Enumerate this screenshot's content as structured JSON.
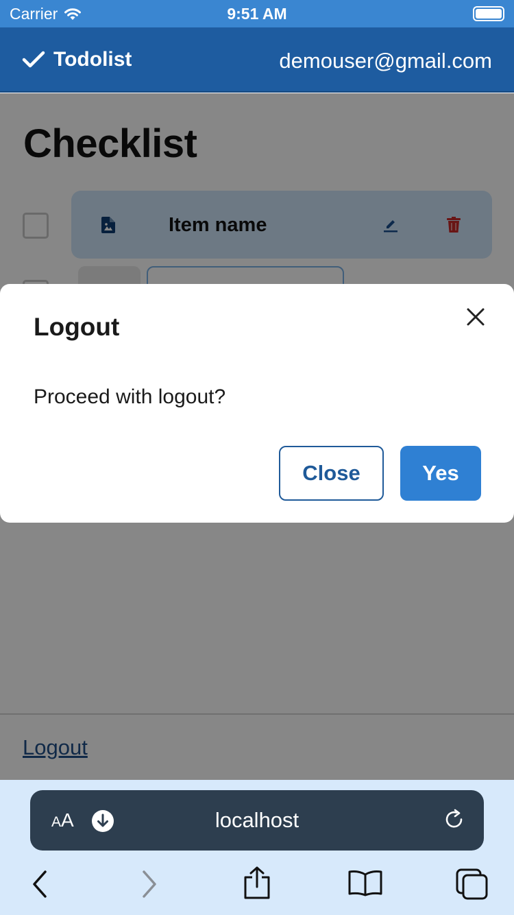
{
  "status_bar": {
    "carrier": "Carrier",
    "time": "9:51 AM"
  },
  "navbar": {
    "brand": "Todolist",
    "email": "demouser@gmail.com"
  },
  "page": {
    "title": "Checklist"
  },
  "checklist": {
    "item_name": "Item name"
  },
  "footer": {
    "logout": "Logout"
  },
  "modal": {
    "title": "Logout",
    "body": "Proceed with logout?",
    "close_label": "Close",
    "confirm_label": "Yes"
  },
  "browser": {
    "text_size": "AA",
    "url": "localhost"
  },
  "colors": {
    "navbar": "#1e5ca0",
    "status_bar": "#3a86d1",
    "primary_button": "#2f80d3",
    "item_card": "#cfe4fa",
    "delete_icon": "#c62828",
    "url_bar": "#2d3e4f",
    "browser_toolbar": "#d7e9fb"
  },
  "icons": {
    "brand": "check-icon",
    "item_file": "file-image-icon",
    "item_edit": "pencil-icon",
    "item_delete": "trash-icon",
    "modal_close": "close-icon",
    "download": "download-icon",
    "reload": "reload-icon",
    "toolbar": [
      "back-icon",
      "forward-icon",
      "share-icon",
      "bookmarks-icon",
      "tabs-icon"
    ]
  }
}
